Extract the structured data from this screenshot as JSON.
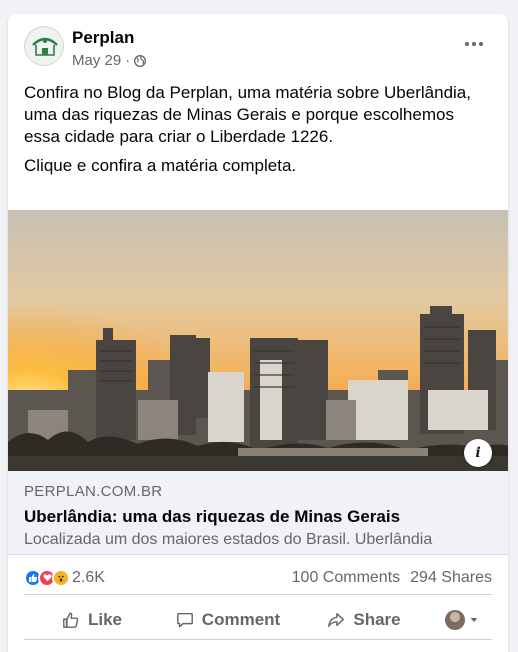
{
  "post": {
    "page_name": "Perplan",
    "date": "May 29",
    "separator": "·",
    "privacy_icon": "globe-icon",
    "more_icon": "more-options-icon",
    "text_paragraphs": [
      "Confira no Blog da Perplan, uma matéria sobre Uberlândia, uma das riquezas de Minas Gerais e porque escolhemos essa cidade para criar o Liberdade 1226.",
      "Clique e confira a matéria completa."
    ]
  },
  "link": {
    "domain": "PERPLAN.COM.BR",
    "title": "Uberlândia: uma das riquezas de Minas Gerais",
    "description": "Localizada um dos maiores estados do Brasil. Uberlândia",
    "info_label": "i"
  },
  "stats": {
    "reaction_count": "2.6K",
    "comments": "100 Comments",
    "shares": "294 Shares",
    "reaction_types": [
      "like",
      "love",
      "wow"
    ]
  },
  "actions": {
    "like": "Like",
    "comment": "Comment",
    "share": "Share"
  },
  "colors": {
    "accent": "#1877f2",
    "secondary_text": "#65676b",
    "sky_top": "#c9c2b4",
    "sun": "#ffb22a"
  }
}
